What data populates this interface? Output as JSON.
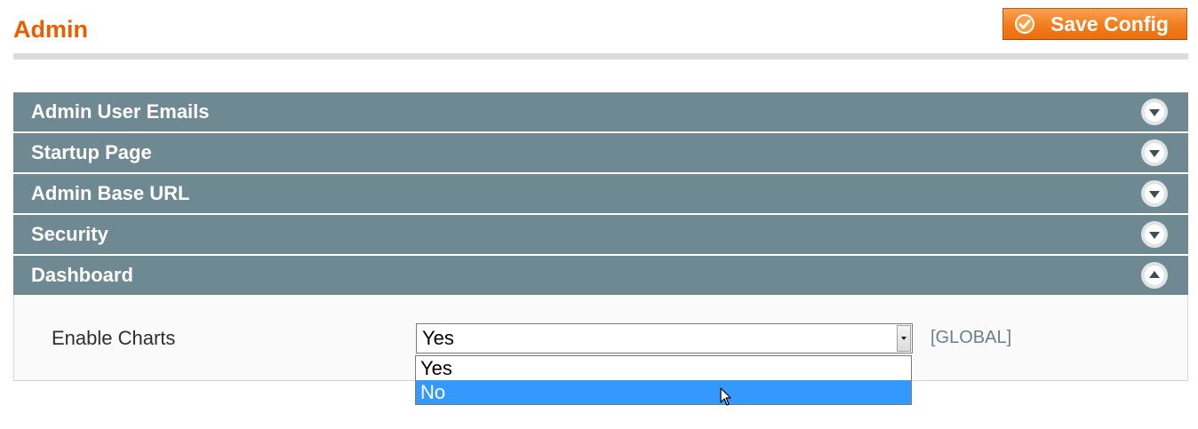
{
  "page": {
    "title": "Admin"
  },
  "toolbar": {
    "save_label": "Save Config",
    "save_icon": "check-circle-icon"
  },
  "sections": [
    {
      "label": "Admin User Emails",
      "state": "collapsed",
      "icon": "chevron-down-circle-icon"
    },
    {
      "label": "Startup Page",
      "state": "collapsed",
      "icon": "chevron-down-circle-icon"
    },
    {
      "label": "Admin Base URL",
      "state": "collapsed",
      "icon": "chevron-down-circle-icon"
    },
    {
      "label": "Security",
      "state": "collapsed",
      "icon": "chevron-down-circle-icon"
    },
    {
      "label": "Dashboard",
      "state": "expanded",
      "icon": "chevron-up-circle-icon"
    }
  ],
  "dashboard": {
    "field_label": "Enable Charts",
    "value": "Yes",
    "scope": "[GLOBAL]",
    "options": [
      "Yes",
      "No"
    ],
    "highlighted_option": "No"
  },
  "colors": {
    "accent": "#eb5e00",
    "section_header": "#6f8992",
    "highlight": "#3399ff"
  }
}
